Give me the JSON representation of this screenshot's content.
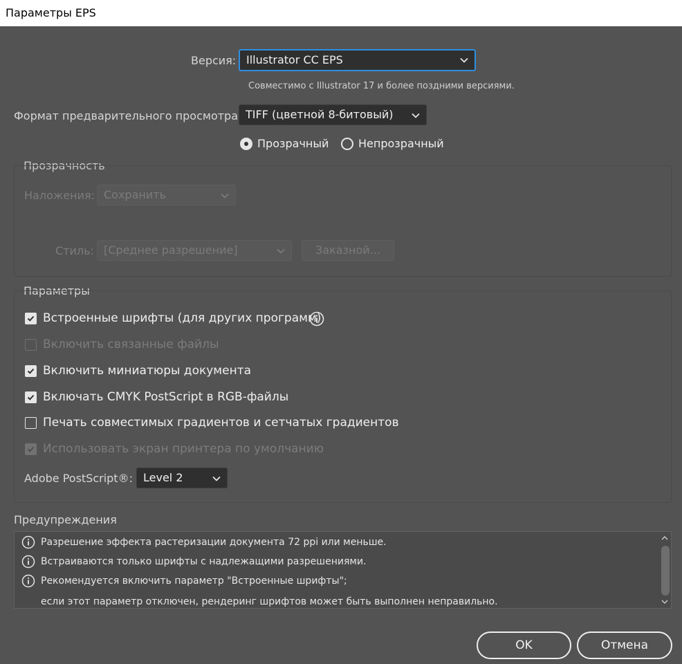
{
  "window": {
    "title": "Параметры EPS"
  },
  "version": {
    "label": "Версия:",
    "value": "Illustrator CC EPS",
    "note": "Совместимо с Illustrator 17 и более поздними версиями."
  },
  "preview": {
    "label": "Формат предварительного просмотра:",
    "value": "TIFF (цветной 8-битовый)",
    "radio_transparent": "Прозрачный",
    "radio_opaque": "Непрозрачный",
    "selected": "transparent"
  },
  "transparency": {
    "heading": "Прозрачность",
    "overprints_label": "Наложения:",
    "overprints_value": "Сохранить",
    "style_label": "Стиль:",
    "style_value": "[Среднее разрешение]",
    "custom_button": "Заказной..."
  },
  "options": {
    "heading": "Параметры",
    "items": [
      {
        "label": "Встроенные шрифты (для других программ)",
        "checked": true,
        "enabled": true
      },
      {
        "label": "Включить связанные файлы",
        "checked": false,
        "enabled": false
      },
      {
        "label": "Включить миниатюры документа",
        "checked": true,
        "enabled": true
      },
      {
        "label": "Включать CMYK PostScript в RGB-файлы",
        "checked": true,
        "enabled": true
      },
      {
        "label": "Печать совместимых градиентов и сетчатых градиентов",
        "checked": false,
        "enabled": true
      },
      {
        "label": "Использовать экран принтера по умолчанию",
        "checked": true,
        "enabled": false
      }
    ],
    "postscript_label": "Adobe PostScript®:",
    "postscript_value": "Level 2"
  },
  "warnings": {
    "heading": "Предупреждения",
    "lines": [
      "Разрешение эффекта растеризации документа 72 ppi или меньше.",
      "Встраиваются только шрифты с надлежащими разрешениями.",
      "Рекомендуется включить параметр \"Встроенные шрифты\";",
      "если этот параметр отключен, рендеринг шрифтов может быть выполнен неправильно."
    ]
  },
  "buttons": {
    "ok": "OK",
    "cancel": "Отмена"
  }
}
